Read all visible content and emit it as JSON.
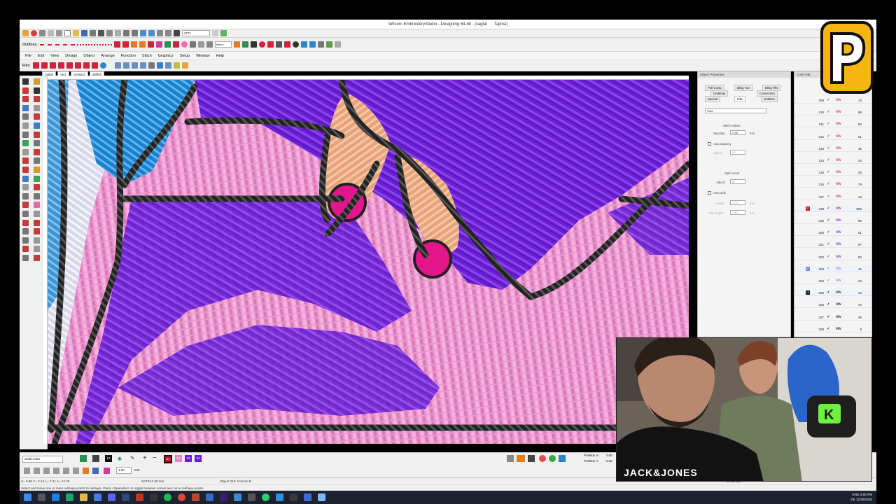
{
  "window": {
    "title": "Wilcom EmbroideryStudio - Designing 64-bit - [caglar",
    "title_extra": "Tajima]"
  },
  "outlines_label": "Outlines:",
  "fills_label": "Fills:",
  "toolbar": {
    "stitch_count_field": "2771",
    "metric_select": "Metric"
  },
  "menu": [
    "File",
    "Edit",
    "View",
    "Design",
    "Object",
    "Arrange",
    "Function",
    "Stitch",
    "Graphics",
    "Setup",
    "Window",
    "Help"
  ],
  "doc_tabs": [
    "caglar",
    "ver1",
    "Design2",
    "dgfhhh"
  ],
  "object_properties": {
    "title": "Object Properties",
    "tabs_row1": [
      "Pull Comp",
      "Bling Run",
      "Bling Fills"
    ],
    "tabs_row2": [
      "Underlay",
      "Connectors"
    ],
    "tabs_row3": [
      "Special",
      "Fills",
      "Outlines"
    ],
    "fill_type": "Satin",
    "stitch_values_label": "Stitch values",
    "spacing_label": "Spacing:",
    "spacing_value": "0.38",
    "spacing_unit": "mm",
    "auto_spacing_label": "Auto spacing",
    "adjust_label1": "Adjust:",
    "adjust_value1": "90",
    "satin_count_label": "Satin count",
    "adjust_label2": "Adjust:",
    "adjust_value2": "1",
    "auto_split_label": "Auto split",
    "length_label": "Length:",
    "length_value": "7.00",
    "minlength_label": "Min length:",
    "minlength_value": "0.90",
    "mm": "mm"
  },
  "color_objects": {
    "title": "Color-Obj",
    "rows": [
      {
        "color": "",
        "num": "309",
        "count": "13",
        "cc": "#cf2a64"
      },
      {
        "color": "",
        "num": "310",
        "count": "96",
        "cc": "#cf2a64"
      },
      {
        "color": "",
        "num": "311",
        "count": "63",
        "cc": "#cf2a64"
      },
      {
        "color": "",
        "num": "312",
        "count": "91",
        "cc": "#cf2a64"
      },
      {
        "color": "",
        "num": "313",
        "count": "35",
        "cc": "#cf2a64"
      },
      {
        "color": "",
        "num": "314",
        "count": "20",
        "cc": "#cf2a64"
      },
      {
        "color": "",
        "num": "315",
        "count": "29",
        "cc": "#cf2a64"
      },
      {
        "color": "",
        "num": "316",
        "count": "79",
        "cc": "#cf2a64"
      },
      {
        "color": "",
        "num": "317",
        "count": "13",
        "cc": "#cf2a64"
      },
      {
        "color": "27",
        "num": "318",
        "count": "966",
        "cc": "#c0151f"
      },
      {
        "color": "",
        "num": "319",
        "count": "92",
        "cc": "#6a1fd6"
      },
      {
        "color": "",
        "num": "320",
        "count": "51",
        "cc": "#6a1fd6"
      },
      {
        "color": "",
        "num": "321",
        "count": "67",
        "cc": "#6a1fd6"
      },
      {
        "color": "",
        "num": "322",
        "count": "50",
        "cc": "#6a1fd6"
      },
      {
        "color": "17",
        "num": "323",
        "count": "15",
        "cc": "#7a8bd9"
      },
      {
        "color": "",
        "num": "324",
        "count": "33",
        "cc": "#7a8bd9"
      },
      {
        "color": "13",
        "num": "325",
        "count": "13",
        "cc": "#111111"
      },
      {
        "color": "",
        "num": "326",
        "count": "70",
        "cc": "#111111"
      },
      {
        "color": "",
        "num": "327",
        "count": "49",
        "cc": "#111111"
      },
      {
        "color": "",
        "num": "328",
        "count": "9",
        "cc": "#111111"
      }
    ]
  },
  "bottom": {
    "color_mode": "Solid Color",
    "swatches": [
      "13",
      "27",
      "17",
      "33",
      "34"
    ],
    "position_x_label": "Position X:",
    "position_x_value": "0.00",
    "position_y_label": "Position Y:",
    "position_y_value": "0.00",
    "zoom_value": "1.00",
    "mm": "mm"
  },
  "status": {
    "coords": "X= 0.89 Y= 2.14 L= 7.21 A= 17.25",
    "stitch_info": "SATIN 0.38 mm",
    "object_info": "Object 318: Column B",
    "jump": "Jump (M)",
    "hint": "Select and move one or more reshape points to reshape. Press <Spacebar> to toggle between corner and curve reshape points."
  },
  "taskbar": {
    "lang": "ENG",
    "locale": "DE",
    "time": "3:00 PM",
    "date": "12/29/2025"
  },
  "webcam": {
    "shirt_text": "JACK&JONES"
  },
  "colors": {
    "purple": "#6a1fd6",
    "pink": "#ec94cd",
    "peach": "#efb38a",
    "magenta": "#e2168a",
    "blue": "#2b96e0",
    "black_outline": "#2a2a2a",
    "logo_yellow": "#f6b512"
  }
}
